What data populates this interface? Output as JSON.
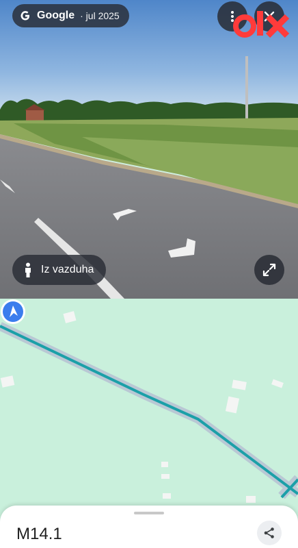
{
  "streetview": {
    "provider": "Google",
    "date": "jul 2025",
    "aerial_label": "Iz vazduha",
    "icons": {
      "google": "google-g-icon",
      "menu": "more-vert-icon",
      "close": "close-icon",
      "person": "person-icon",
      "expand": "expand-icon"
    }
  },
  "watermark": {
    "brand": "olx",
    "color": "#ff3b3b"
  },
  "map": {
    "route_color": "#1ba0a8",
    "location_color": "#3b7ded"
  },
  "place": {
    "title": "M14.1"
  },
  "sheet": {
    "share_icon": "share-icon"
  }
}
